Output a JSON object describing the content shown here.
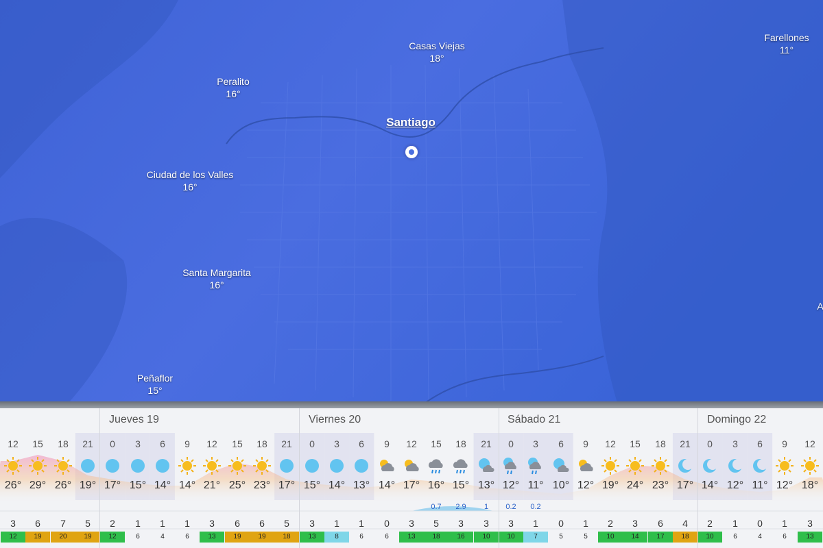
{
  "map": {
    "places": [
      {
        "name": "Casas Viejas",
        "temp": "18°"
      },
      {
        "name": "Farellones",
        "temp": "11°"
      },
      {
        "name": "Peralito",
        "temp": "16°"
      },
      {
        "name": "Santiago",
        "temp": ""
      },
      {
        "name": "Ciudad de los Valles",
        "temp": "16°"
      },
      {
        "name": "Santa Margarita",
        "temp": "16°"
      },
      {
        "name": "Peñaflor",
        "temp": "15°"
      }
    ],
    "edge_letter": "A"
  },
  "forecast": {
    "days": [
      "Jueves 19",
      "Viernes 20",
      "Sábado 21",
      "Domingo 22"
    ],
    "hours": [
      {
        "h": "12",
        "icon": "sun-icon",
        "t": "26°",
        "p": "",
        "w": "3",
        "g": "12",
        "gc": "#2fbe4a",
        "night": false
      },
      {
        "h": "15",
        "icon": "sun-icon",
        "t": "29°",
        "p": "",
        "w": "6",
        "g": "19",
        "gc": "#e0a412",
        "night": false
      },
      {
        "h": "18",
        "icon": "sun-icon",
        "t": "26°",
        "p": "",
        "w": "7",
        "g": "20",
        "gc": "#e0a412",
        "night": false
      },
      {
        "h": "21",
        "icon": "clear-night-icon",
        "t": "19°",
        "p": "",
        "w": "5",
        "g": "19",
        "gc": "#e0a412",
        "night": true
      },
      {
        "h": "0",
        "icon": "clear-night-icon",
        "t": "17°",
        "p": "",
        "w": "2",
        "g": "12",
        "gc": "#2fbe4a",
        "night": true
      },
      {
        "h": "3",
        "icon": "clear-night-icon",
        "t": "15°",
        "p": "",
        "w": "1",
        "g": "6",
        "gc": "#f2f3f6",
        "night": true
      },
      {
        "h": "6",
        "icon": "clear-night-icon",
        "t": "14°",
        "p": "",
        "w": "1",
        "g": "4",
        "gc": "#f2f3f6",
        "night": true
      },
      {
        "h": "9",
        "icon": "sun-icon",
        "t": "14°",
        "p": "",
        "w": "1",
        "g": "6",
        "gc": "#f2f3f6",
        "night": false
      },
      {
        "h": "12",
        "icon": "sun-icon",
        "t": "21°",
        "p": "",
        "w": "3",
        "g": "13",
        "gc": "#2fbe4a",
        "night": false
      },
      {
        "h": "15",
        "icon": "sun-icon",
        "t": "25°",
        "p": "",
        "w": "6",
        "g": "19",
        "gc": "#e0a412",
        "night": false
      },
      {
        "h": "18",
        "icon": "sun-icon",
        "t": "23°",
        "p": "",
        "w": "6",
        "g": "19",
        "gc": "#e0a412",
        "night": false
      },
      {
        "h": "21",
        "icon": "clear-night-icon",
        "t": "17°",
        "p": "",
        "w": "5",
        "g": "18",
        "gc": "#e0a412",
        "night": true
      },
      {
        "h": "0",
        "icon": "clear-night-icon",
        "t": "15°",
        "p": "",
        "w": "3",
        "g": "13",
        "gc": "#2fbe4a",
        "night": true
      },
      {
        "h": "3",
        "icon": "clear-night-icon",
        "t": "14°",
        "p": "",
        "w": "1",
        "g": "8",
        "gc": "#7fd6e8",
        "night": true
      },
      {
        "h": "6",
        "icon": "clear-night-icon",
        "t": "13°",
        "p": "",
        "w": "1",
        "g": "6",
        "gc": "#f2f3f6",
        "night": true
      },
      {
        "h": "9",
        "icon": "partly-cloudy-icon",
        "t": "14°",
        "p": "",
        "w": "0",
        "g": "6",
        "gc": "#f2f3f6",
        "night": false
      },
      {
        "h": "12",
        "icon": "partly-cloudy-icon",
        "t": "17°",
        "p": "",
        "w": "3",
        "g": "13",
        "gc": "#2fbe4a",
        "night": false
      },
      {
        "h": "15",
        "icon": "rain-icon",
        "t": "16°",
        "p": "0.7",
        "w": "5",
        "g": "18",
        "gc": "#2fbe4a",
        "night": false
      },
      {
        "h": "18",
        "icon": "rain-icon",
        "t": "15°",
        "p": "2.9",
        "w": "3",
        "g": "16",
        "gc": "#2fbe4a",
        "night": false
      },
      {
        "h": "21",
        "icon": "night-cloud-icon",
        "t": "13°",
        "p": "1",
        "w": "3",
        "g": "10",
        "gc": "#2fbe4a",
        "night": true
      },
      {
        "h": "0",
        "icon": "night-rain-icon",
        "t": "12°",
        "p": "0.2",
        "w": "3",
        "g": "10",
        "gc": "#2fbe4a",
        "night": true
      },
      {
        "h": "3",
        "icon": "night-rain-icon",
        "t": "11°",
        "p": "0.2",
        "w": "1",
        "g": "7",
        "gc": "#7fd6e8",
        "night": true
      },
      {
        "h": "6",
        "icon": "night-cloud-icon",
        "t": "10°",
        "p": "",
        "w": "0",
        "g": "5",
        "gc": "#f2f3f6",
        "night": true
      },
      {
        "h": "9",
        "icon": "partly-cloudy-icon",
        "t": "12°",
        "p": "",
        "w": "1",
        "g": "5",
        "gc": "#f2f3f6",
        "night": false
      },
      {
        "h": "12",
        "icon": "sun-icon",
        "t": "19°",
        "p": "",
        "w": "2",
        "g": "10",
        "gc": "#2fbe4a",
        "night": false
      },
      {
        "h": "15",
        "icon": "sun-icon",
        "t": "24°",
        "p": "",
        "w": "3",
        "g": "14",
        "gc": "#2fbe4a",
        "night": false
      },
      {
        "h": "18",
        "icon": "sun-icon",
        "t": "23°",
        "p": "",
        "w": "6",
        "g": "17",
        "gc": "#2fbe4a",
        "night": false
      },
      {
        "h": "21",
        "icon": "moon-icon",
        "t": "17°",
        "p": "",
        "w": "4",
        "g": "18",
        "gc": "#e0a412",
        "night": true
      },
      {
        "h": "0",
        "icon": "moon-icon",
        "t": "14°",
        "p": "",
        "w": "2",
        "g": "10",
        "gc": "#2fbe4a",
        "night": true
      },
      {
        "h": "3",
        "icon": "moon-icon",
        "t": "12°",
        "p": "",
        "w": "1",
        "g": "6",
        "gc": "#f2f3f6",
        "night": true
      },
      {
        "h": "6",
        "icon": "moon-icon",
        "t": "11°",
        "p": "",
        "w": "0",
        "g": "4",
        "gc": "#f2f3f6",
        "night": true
      },
      {
        "h": "9",
        "icon": "sun-icon",
        "t": "12°",
        "p": "",
        "w": "1",
        "g": "6",
        "gc": "#f2f3f6",
        "night": false
      },
      {
        "h": "12",
        "icon": "sun-icon",
        "t": "18°",
        "p": "",
        "w": "3",
        "g": "13",
        "gc": "#2fbe4a",
        "night": false
      }
    ]
  }
}
